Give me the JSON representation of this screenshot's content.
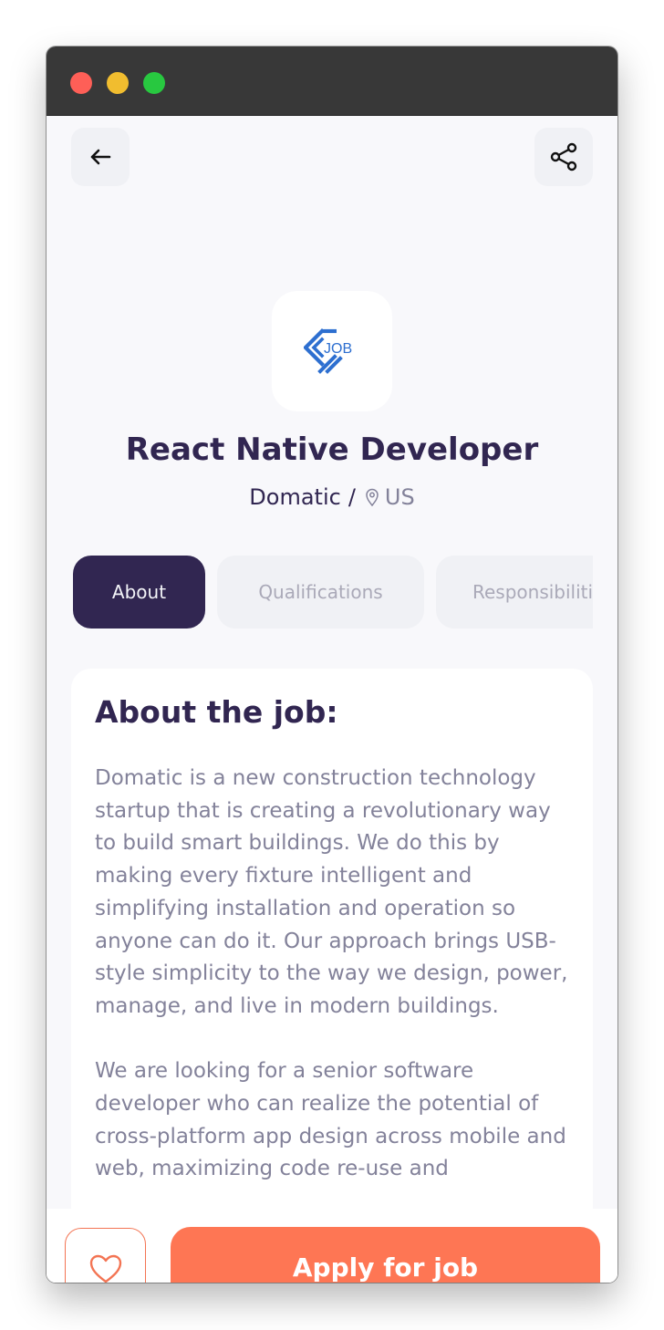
{
  "job": {
    "title": "React Native Developer",
    "company": "Domatic",
    "separator": "/",
    "country": "US",
    "logo_text": "JOB"
  },
  "tabs": [
    {
      "label": "About",
      "active": true
    },
    {
      "label": "Qualifications",
      "active": false
    },
    {
      "label": "Responsibilities",
      "active": false
    }
  ],
  "about": {
    "heading": "About the job:",
    "paragraphs": [
      "Domatic is a new construction technology startup that is creating a revolutionary way to build smart buildings. We do this by making every fixture intelligent and simplifying installation and operation so anyone can do it. Our approach brings USB-style simplicity to the way we design, power, manage, and live in modern buildings.",
      "We are looking for a senior software developer who can realize the potential of cross-platform app design across mobile and web, maximizing code re-use and"
    ]
  },
  "footer": {
    "apply_label": "Apply for job"
  },
  "icons": {
    "back": "arrow-left-icon",
    "share": "share-icon",
    "location": "location-pin-icon",
    "favorite": "heart-icon"
  },
  "colors": {
    "primary": "#312651",
    "tertiary": "#FF7754",
    "gray": "#83829A",
    "background": "#F8F8FB"
  }
}
